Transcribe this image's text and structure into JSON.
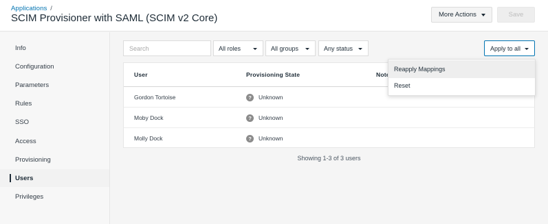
{
  "header": {
    "breadcrumb": "Applications",
    "breadcrumb_sep": "/",
    "title": "SCIM Provisioner with SAML (SCIM v2 Core)",
    "more_actions_label": "More Actions",
    "save_label": "Save"
  },
  "sidebar": {
    "items": [
      {
        "label": "Info"
      },
      {
        "label": "Configuration"
      },
      {
        "label": "Parameters"
      },
      {
        "label": "Rules"
      },
      {
        "label": "SSO"
      },
      {
        "label": "Access"
      },
      {
        "label": "Provisioning"
      },
      {
        "label": "Users"
      },
      {
        "label": "Privileges"
      }
    ],
    "active": "Users"
  },
  "toolbar": {
    "search_placeholder": "Search",
    "roles_filter": "All roles",
    "groups_filter": "All groups",
    "status_filter": "Any status",
    "apply_all_label": "Apply to all"
  },
  "table": {
    "columns": [
      "User",
      "Provisioning State",
      "Note"
    ],
    "rows": [
      {
        "user": "Gordon Tortoise",
        "state": "Unknown"
      },
      {
        "user": "Moby Dock",
        "state": "Unknown"
      },
      {
        "user": "Molly Dock",
        "state": "Unknown"
      }
    ],
    "status_icon": "question-icon",
    "footer": "Showing 1-3 of 3 users"
  },
  "apply_menu": {
    "items": [
      {
        "label": "Reapply Mappings"
      },
      {
        "label": "Reset"
      }
    ]
  },
  "colors": {
    "accent": "#0073b1",
    "title": "#1d2b36",
    "status_icon": "#8b8b8b"
  }
}
